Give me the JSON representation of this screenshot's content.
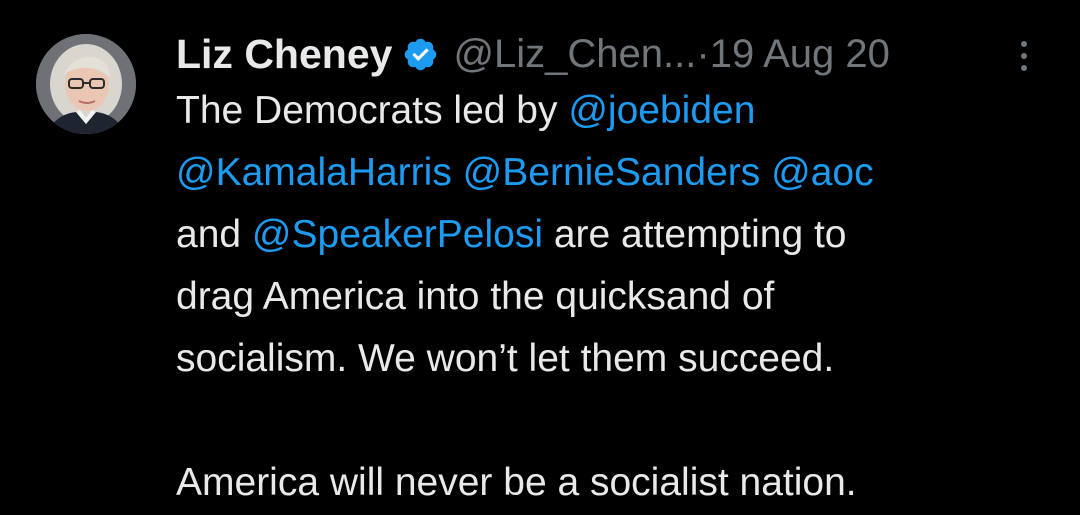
{
  "tweet": {
    "author_name": "Liz Cheney",
    "handle": "@Liz_Chen...",
    "separator": "·",
    "date": "19 Aug 20",
    "verified": true,
    "more_icon": "more-vertical-icon",
    "text": {
      "l1_a": "The Democrats led by ",
      "m_joebiden": "@joebiden",
      "m_kamala": "@KamalaHarris",
      "m_bernie": "@BernieSanders",
      "m_aoc": "@aoc",
      "l3_a": "and ",
      "m_pelosi": "@SpeakerPelosi",
      "l3_b": " are attempting to",
      "l4": "drag America into the quicksand of",
      "l5": "socialism. We won’t let them succeed.",
      "l7": "America will never be a socialist nation."
    }
  },
  "colors": {
    "background": "#000000",
    "text": "#e7e9ea",
    "muted": "#71767b",
    "link": "#1d9bf0",
    "verified_badge": "#1d9bf0"
  }
}
